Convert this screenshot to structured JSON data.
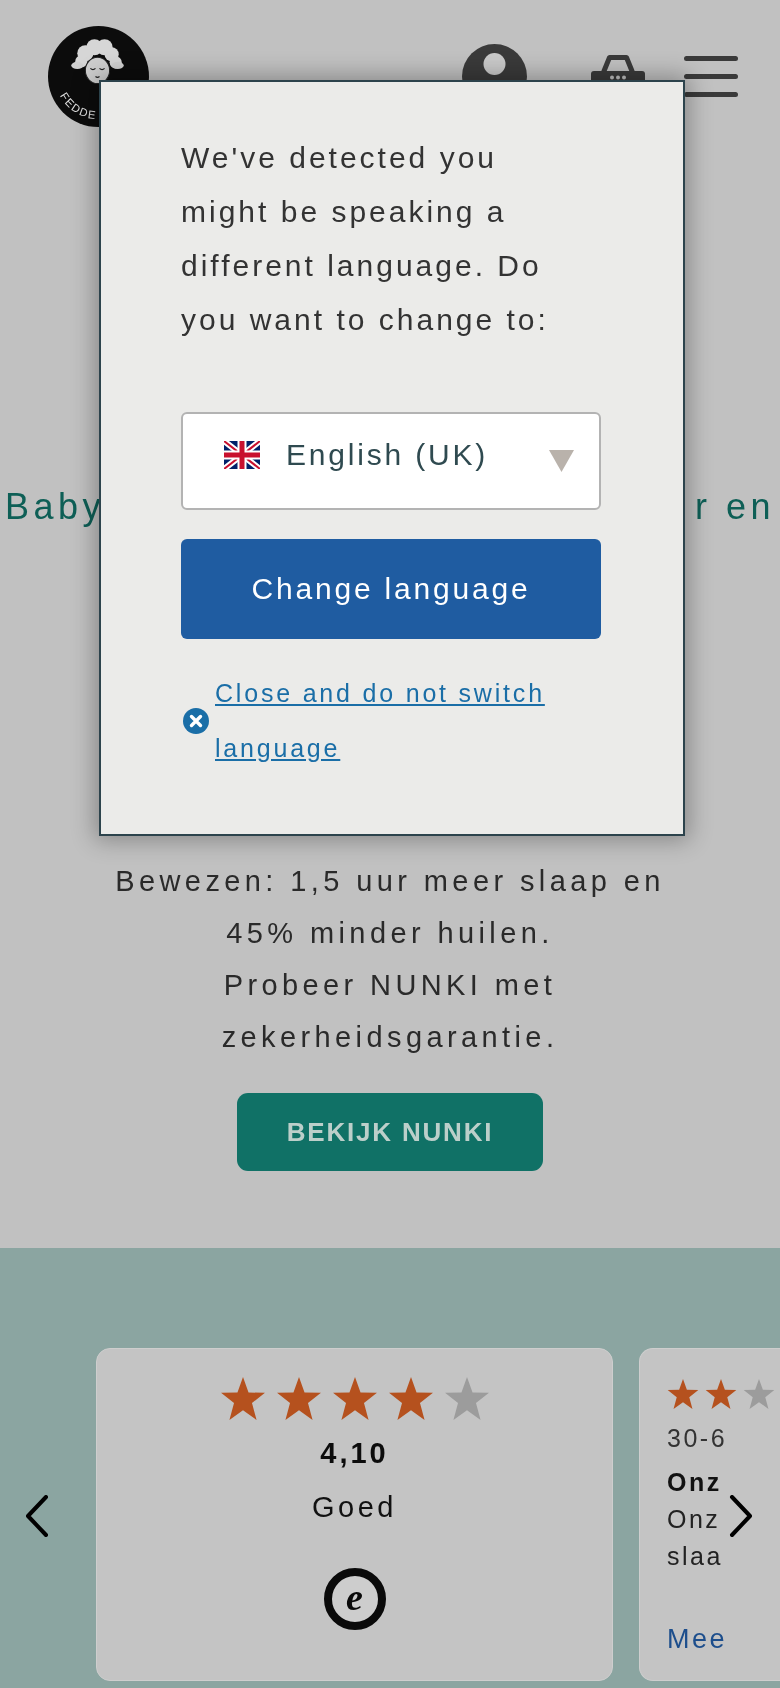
{
  "header": {
    "logo_text": "FEDDE"
  },
  "hero": {
    "heading_left": "Baby",
    "heading_right": "r en",
    "body_lines": [
      "Bewezen: 1,5 uur meer slaap en",
      "45% minder huilen.",
      "Probeer NUNKI met",
      "zekerheidsgarantie."
    ],
    "button": "BEKIJK NUNKI"
  },
  "reviews": {
    "summary": {
      "stars": 4,
      "score": "4,10",
      "label": "Goed",
      "badge_letter": "e"
    },
    "next_review": {
      "stars": 2,
      "date": "30-6",
      "title": "Onz",
      "text_lines": [
        "Onz",
        "slaa"
      ],
      "link": "Mee"
    }
  },
  "language_dialog": {
    "message": "We've detected you might be speaking a different language. Do you want to change to:",
    "language_select": {
      "value": "English (UK)"
    },
    "button": "Change language",
    "close_link": "Close and do not switch language"
  }
}
